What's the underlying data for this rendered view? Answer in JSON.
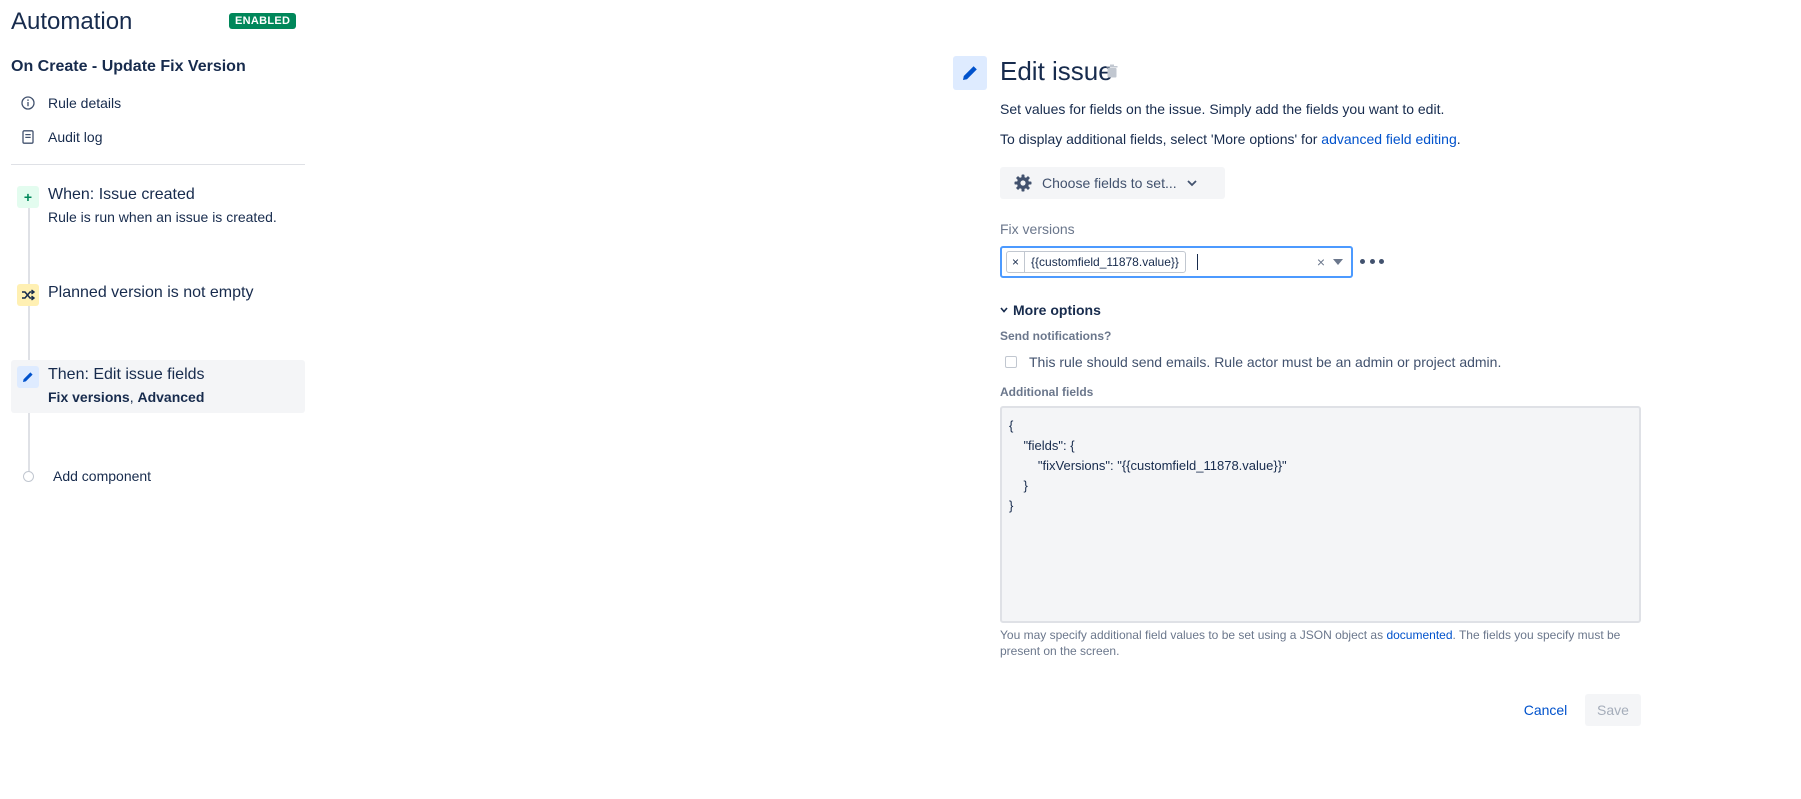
{
  "app": {
    "title": "Automation",
    "status_badge": "ENABLED",
    "status_color": "#00875a"
  },
  "rule": {
    "name": "On Create - Update Fix Version"
  },
  "sidebar": {
    "nav": [
      {
        "label": "Rule details",
        "icon": "info-icon"
      },
      {
        "label": "Audit log",
        "icon": "document-icon"
      }
    ],
    "steps": [
      {
        "title": "When: Issue created",
        "subtitle": "Rule is run when an issue is created.",
        "icon": "plus-icon",
        "color": "#e3fcef"
      },
      {
        "title": "Planned version is not empty",
        "icon": "shuffle-icon",
        "color": "#fff0b3"
      },
      {
        "title": "Then: Edit issue fields",
        "subtitle_bold_1": "Fix versions",
        "subtitle_sep": ", ",
        "subtitle_bold_2": "Advanced",
        "icon": "pencil-icon",
        "color": "#deebff",
        "selected": true
      }
    ],
    "add_component": "Add component"
  },
  "panel": {
    "title": "Edit issue",
    "description": "Set values for fields on the issue. Simply add the fields you want to edit.",
    "advanced_prefix": "To display additional fields, select 'More options' for ",
    "advanced_link": "advanced field editing",
    "advanced_suffix": ".",
    "choose_fields_label": "Choose fields to set...",
    "fix_versions": {
      "label": "Fix versions",
      "tag": "{{customfield_11878.value}}",
      "tag_remove": "×",
      "clear": "×"
    },
    "more_options": {
      "label": "More options",
      "send_notifications_label": "Send notifications?",
      "send_notifications_text": "This rule should send emails. Rule actor must be an admin or project admin.",
      "send_notifications_checked": false,
      "additional_fields_label": "Additional fields",
      "additional_fields_value": "{\n    \"fields\": {\n        \"fixVersions\": \"{{customfield_11878.value}}\"\n    }\n}",
      "help_prefix": "You may specify additional field values to be set using a JSON object as ",
      "help_link": "documented",
      "help_suffix": ". The fields you specify must be present on the screen."
    },
    "buttons": {
      "cancel": "Cancel",
      "save": "Save"
    },
    "accent_color": "#0052cc"
  }
}
